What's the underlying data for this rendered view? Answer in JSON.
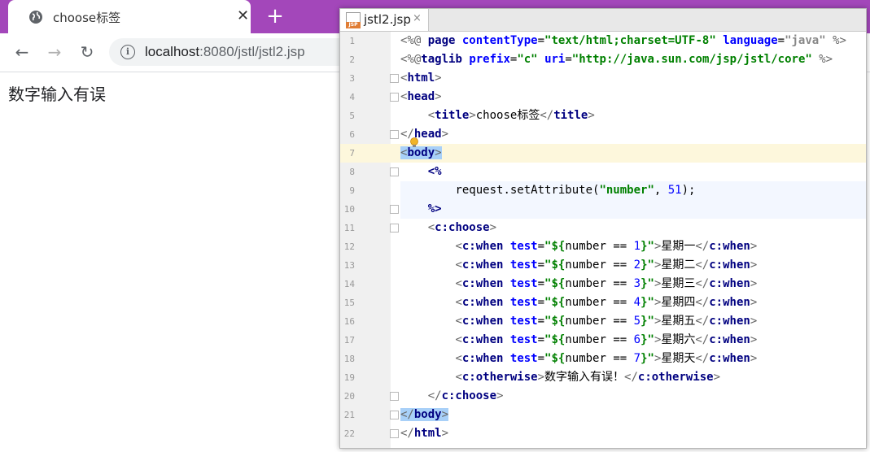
{
  "browser": {
    "tab_title": "choose标签",
    "tab_close": "✕",
    "new_tab": "+",
    "url_host": "localhost",
    "url_path": ":8080/jstl/jstl2.jsp",
    "nav_back": "←",
    "nav_forward": "→",
    "nav_reload": "↻",
    "info": "i"
  },
  "page": {
    "text": "数字输入有误"
  },
  "ide": {
    "tab_label": "jstl2.jsp",
    "tab_close": "×",
    "jsp_badge": "JSP",
    "lines": [
      {
        "n": "1"
      },
      {
        "n": "2"
      },
      {
        "n": "3"
      },
      {
        "n": "4"
      },
      {
        "n": "5"
      },
      {
        "n": "6"
      },
      {
        "n": "7"
      },
      {
        "n": "8"
      },
      {
        "n": "9"
      },
      {
        "n": "10"
      },
      {
        "n": "11"
      },
      {
        "n": "12"
      },
      {
        "n": "13"
      },
      {
        "n": "14"
      },
      {
        "n": "15"
      },
      {
        "n": "16"
      },
      {
        "n": "17"
      },
      {
        "n": "18"
      },
      {
        "n": "19"
      },
      {
        "n": "20"
      },
      {
        "n": "21"
      },
      {
        "n": "22"
      }
    ],
    "code": {
      "l1_open": "<%@ ",
      "l1_page": "page",
      "l1_ct_attr": "contentType",
      "l1_ct_val": "\"text/html;charset=UTF-8\"",
      "l1_lang_attr": "language",
      "l1_lang_val": "\"java\"",
      "l1_close": " %>",
      "l2_open": "<%@",
      "l2_taglib": "taglib",
      "l2_prefix_attr": "prefix",
      "l2_prefix_val": "\"c\"",
      "l2_uri_attr": "uri",
      "l2_uri_val": "\"http://java.sun.com/jsp/jstl/core\"",
      "l2_close": " %>",
      "html": "html",
      "head": "head",
      "title": "title",
      "title_text": "choose标签",
      "body": "body",
      "java_open": "<%",
      "java_stmt_a": "request.setAttribute(",
      "java_stmt_str": "\"number\"",
      "java_stmt_b": ", ",
      "java_stmt_num": "51",
      "java_stmt_c": ");",
      "java_close": "%>",
      "choose": "c:choose",
      "when": "c:when",
      "test": "test",
      "otherwise": "c:otherwise",
      "otherwise_text": "数字输入有误！",
      "cases": [
        {
          "num": "1",
          "day": "星期一"
        },
        {
          "num": "2",
          "day": "星期二"
        },
        {
          "num": "3",
          "day": "星期三"
        },
        {
          "num": "4",
          "day": "星期四"
        },
        {
          "num": "5",
          "day": "星期五"
        },
        {
          "num": "6",
          "day": "星期六"
        },
        {
          "num": "7",
          "day": "星期天"
        }
      ]
    }
  }
}
